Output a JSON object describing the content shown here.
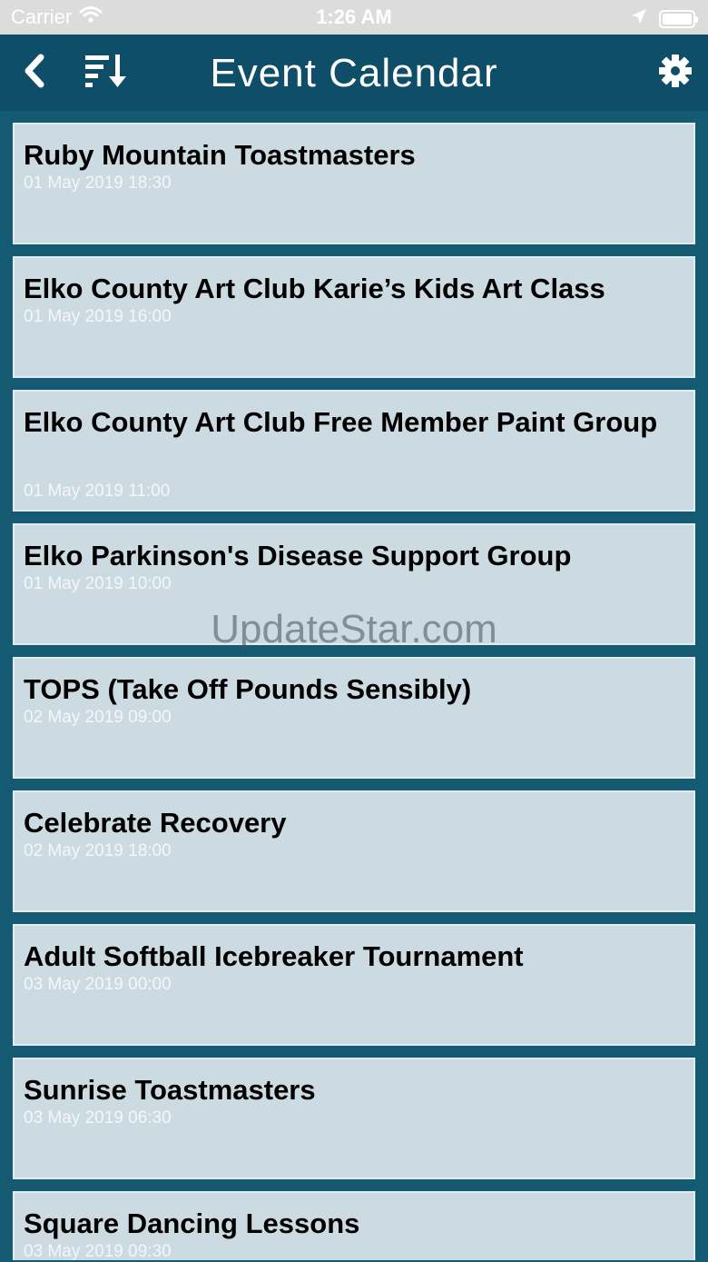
{
  "status_bar": {
    "carrier": "Carrier",
    "time": "1:26 AM",
    "icons": [
      "wifi-icon",
      "location-arrow-icon",
      "battery-icon"
    ]
  },
  "nav": {
    "title": "Event Calendar",
    "icons": [
      "chevron-left-icon",
      "sort-descending-icon",
      "gear-icon"
    ]
  },
  "events": [
    {
      "title": "Ruby Mountain Toastmasters",
      "date": "01 May 2019 18:30"
    },
    {
      "title": "Elko County Art Club Karie’s Kids Art Class",
      "date": "01 May 2019 16:00"
    },
    {
      "title": "Elko County Art Club Free Member Paint Group",
      "date": "01 May 2019 11:00"
    },
    {
      "title": "Elko Parkinson's Disease Support Group",
      "date": "01 May 2019 10:00"
    },
    {
      "title": "TOPS (Take Off Pounds Sensibly)",
      "date": "02 May 2019 09:00"
    },
    {
      "title": "Celebrate Recovery",
      "date": "02 May 2019 18:00"
    },
    {
      "title": "Adult Softball Icebreaker Tournament",
      "date": "03 May 2019 00:00"
    },
    {
      "title": "Sunrise Toastmasters",
      "date": "03 May 2019 06:30"
    },
    {
      "title": "Square Dancing Lessons",
      "date": "03 May 2019 09:30"
    }
  ],
  "watermark": "UpdateStar.com",
  "colors": {
    "nav_background": "#0f4e68",
    "page_background": "#145a73",
    "card_background": "#ccdae2",
    "date_text": "#f3f7f9"
  }
}
